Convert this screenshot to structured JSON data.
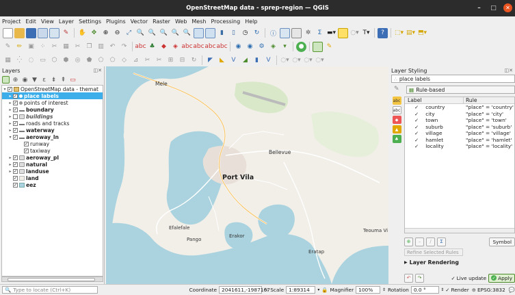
{
  "window": {
    "title": "OpenStreetMap data - sprep-region — QGIS"
  },
  "menu": [
    "Project",
    "Edit",
    "View",
    "Layer",
    "Settings",
    "Plugins",
    "Vector",
    "Raster",
    "Web",
    "Mesh",
    "Processing",
    "Help"
  ],
  "layers_panel": {
    "title": "Layers",
    "items": [
      {
        "label": "OpenStreetMap data - themat",
        "indent": 0,
        "expanded": true,
        "checked": true,
        "bold": false,
        "italic": false,
        "selected": false,
        "icon": "group-icon"
      },
      {
        "label": "place labels",
        "indent": 1,
        "expanded": false,
        "checked": true,
        "bold": true,
        "italic": false,
        "selected": true,
        "icon": "point-icon"
      },
      {
        "label": "points of interest",
        "indent": 1,
        "expanded": false,
        "checked": true,
        "bold": false,
        "italic": false,
        "selected": false,
        "icon": "point-icon"
      },
      {
        "label": "boundary",
        "indent": 1,
        "expanded": false,
        "checked": true,
        "bold": true,
        "italic": false,
        "selected": false,
        "icon": "line-icon"
      },
      {
        "label": "buildings",
        "indent": 1,
        "expanded": false,
        "checked": false,
        "bold": true,
        "italic": true,
        "selected": false,
        "icon": "polygon-icon"
      },
      {
        "label": "roads and tracks",
        "indent": 1,
        "expanded": false,
        "checked": true,
        "bold": false,
        "italic": false,
        "selected": false,
        "icon": "line-icon"
      },
      {
        "label": "waterway",
        "indent": 1,
        "expanded": false,
        "checked": true,
        "bold": true,
        "italic": false,
        "selected": false,
        "icon": "line-icon"
      },
      {
        "label": "aeroway_ln",
        "indent": 1,
        "expanded": true,
        "checked": true,
        "bold": true,
        "italic": false,
        "selected": false,
        "icon": "line-icon"
      },
      {
        "label": "runway",
        "indent": 3,
        "expanded": null,
        "checked": true,
        "bold": false,
        "italic": false,
        "selected": false,
        "icon": ""
      },
      {
        "label": "taxiway",
        "indent": 3,
        "expanded": null,
        "checked": true,
        "bold": false,
        "italic": false,
        "selected": false,
        "icon": ""
      },
      {
        "label": "aeroway_pl",
        "indent": 1,
        "expanded": false,
        "checked": true,
        "bold": true,
        "italic": false,
        "selected": false,
        "icon": "polygon-icon"
      },
      {
        "label": "natural",
        "indent": 1,
        "expanded": false,
        "checked": true,
        "bold": true,
        "italic": false,
        "selected": false,
        "icon": "polygon-icon"
      },
      {
        "label": "landuse",
        "indent": 1,
        "expanded": false,
        "checked": true,
        "bold": true,
        "italic": false,
        "selected": false,
        "icon": "polygon-icon"
      },
      {
        "label": "land",
        "indent": 1,
        "expanded": null,
        "checked": true,
        "bold": true,
        "italic": false,
        "selected": false,
        "icon": "land-swatch"
      },
      {
        "label": "eez",
        "indent": 1,
        "expanded": null,
        "checked": true,
        "bold": true,
        "italic": false,
        "selected": false,
        "icon": "eez-swatch"
      }
    ]
  },
  "map": {
    "labels": {
      "mele": "Mele",
      "bellevue": "Bellevue",
      "port_vila": "Port Vila",
      "efalefale": "Efalefale",
      "pango": "Pango",
      "erakor": "Erakor",
      "eratap": "Eratap",
      "teouma": "Teouma Vi"
    }
  },
  "styling": {
    "title": "Layer Styling",
    "layer": "place labels",
    "renderer": "Rule-based",
    "columns": {
      "label": "Label",
      "rule": "Rule"
    },
    "rules": [
      {
        "label": "country",
        "rule": "\"place\" = 'country'"
      },
      {
        "label": "city",
        "rule": "\"place\" = 'city'"
      },
      {
        "label": "town",
        "rule": "\"place\" = 'town'"
      },
      {
        "label": "suburb",
        "rule": "\"place\" = 'suburb'"
      },
      {
        "label": "village",
        "rule": "\"place\" = 'village'"
      },
      {
        "label": "hamlet",
        "rule": "\"place\" = 'hamlet'"
      },
      {
        "label": "locality",
        "rule": "\"place\" = 'locality'"
      }
    ],
    "symbol_button": "Symbol",
    "refine_button": "Refine Selected Rules",
    "layer_rendering": "Layer Rendering",
    "live_update": "Live update",
    "apply": "Apply"
  },
  "status": {
    "locator_placeholder": "Type to locate (Ctrl+K)",
    "coordinate_label": "Coordinate",
    "coordinate": "2041611,-1987167",
    "scale_label": "Scale",
    "scale": "1:89314",
    "magnifier_label": "Magnifier",
    "magnifier": "100%",
    "rotation_label": "Rotation",
    "rotation": "0.0 °",
    "render": "Render",
    "crs": "EPSG:3832"
  },
  "colors": {
    "water": "#aad3df",
    "land": "#f2efe9",
    "selection": "#3daee9",
    "accent": "#589632"
  }
}
